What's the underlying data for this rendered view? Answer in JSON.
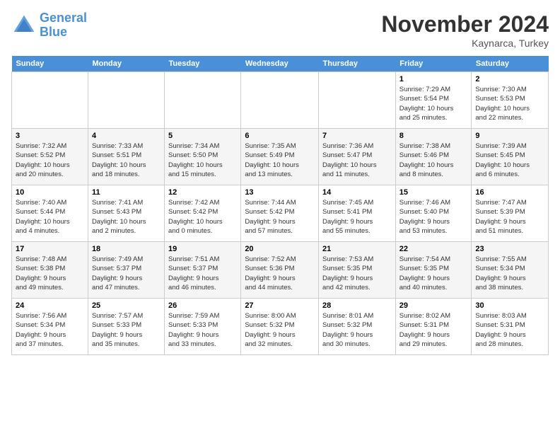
{
  "logo": {
    "line1": "General",
    "line2": "Blue"
  },
  "title": "November 2024",
  "subtitle": "Kaynarca, Turkey",
  "days_of_week": [
    "Sunday",
    "Monday",
    "Tuesday",
    "Wednesday",
    "Thursday",
    "Friday",
    "Saturday"
  ],
  "weeks": [
    [
      {
        "day": "",
        "info": ""
      },
      {
        "day": "",
        "info": ""
      },
      {
        "day": "",
        "info": ""
      },
      {
        "day": "",
        "info": ""
      },
      {
        "day": "",
        "info": ""
      },
      {
        "day": "1",
        "info": "Sunrise: 7:29 AM\nSunset: 5:54 PM\nDaylight: 10 hours\nand 25 minutes."
      },
      {
        "day": "2",
        "info": "Sunrise: 7:30 AM\nSunset: 5:53 PM\nDaylight: 10 hours\nand 22 minutes."
      }
    ],
    [
      {
        "day": "3",
        "info": "Sunrise: 7:32 AM\nSunset: 5:52 PM\nDaylight: 10 hours\nand 20 minutes."
      },
      {
        "day": "4",
        "info": "Sunrise: 7:33 AM\nSunset: 5:51 PM\nDaylight: 10 hours\nand 18 minutes."
      },
      {
        "day": "5",
        "info": "Sunrise: 7:34 AM\nSunset: 5:50 PM\nDaylight: 10 hours\nand 15 minutes."
      },
      {
        "day": "6",
        "info": "Sunrise: 7:35 AM\nSunset: 5:49 PM\nDaylight: 10 hours\nand 13 minutes."
      },
      {
        "day": "7",
        "info": "Sunrise: 7:36 AM\nSunset: 5:47 PM\nDaylight: 10 hours\nand 11 minutes."
      },
      {
        "day": "8",
        "info": "Sunrise: 7:38 AM\nSunset: 5:46 PM\nDaylight: 10 hours\nand 8 minutes."
      },
      {
        "day": "9",
        "info": "Sunrise: 7:39 AM\nSunset: 5:45 PM\nDaylight: 10 hours\nand 6 minutes."
      }
    ],
    [
      {
        "day": "10",
        "info": "Sunrise: 7:40 AM\nSunset: 5:44 PM\nDaylight: 10 hours\nand 4 minutes."
      },
      {
        "day": "11",
        "info": "Sunrise: 7:41 AM\nSunset: 5:43 PM\nDaylight: 10 hours\nand 2 minutes."
      },
      {
        "day": "12",
        "info": "Sunrise: 7:42 AM\nSunset: 5:42 PM\nDaylight: 10 hours\nand 0 minutes."
      },
      {
        "day": "13",
        "info": "Sunrise: 7:44 AM\nSunset: 5:42 PM\nDaylight: 9 hours\nand 57 minutes."
      },
      {
        "day": "14",
        "info": "Sunrise: 7:45 AM\nSunset: 5:41 PM\nDaylight: 9 hours\nand 55 minutes."
      },
      {
        "day": "15",
        "info": "Sunrise: 7:46 AM\nSunset: 5:40 PM\nDaylight: 9 hours\nand 53 minutes."
      },
      {
        "day": "16",
        "info": "Sunrise: 7:47 AM\nSunset: 5:39 PM\nDaylight: 9 hours\nand 51 minutes."
      }
    ],
    [
      {
        "day": "17",
        "info": "Sunrise: 7:48 AM\nSunset: 5:38 PM\nDaylight: 9 hours\nand 49 minutes."
      },
      {
        "day": "18",
        "info": "Sunrise: 7:49 AM\nSunset: 5:37 PM\nDaylight: 9 hours\nand 47 minutes."
      },
      {
        "day": "19",
        "info": "Sunrise: 7:51 AM\nSunset: 5:37 PM\nDaylight: 9 hours\nand 46 minutes."
      },
      {
        "day": "20",
        "info": "Sunrise: 7:52 AM\nSunset: 5:36 PM\nDaylight: 9 hours\nand 44 minutes."
      },
      {
        "day": "21",
        "info": "Sunrise: 7:53 AM\nSunset: 5:35 PM\nDaylight: 9 hours\nand 42 minutes."
      },
      {
        "day": "22",
        "info": "Sunrise: 7:54 AM\nSunset: 5:35 PM\nDaylight: 9 hours\nand 40 minutes."
      },
      {
        "day": "23",
        "info": "Sunrise: 7:55 AM\nSunset: 5:34 PM\nDaylight: 9 hours\nand 38 minutes."
      }
    ],
    [
      {
        "day": "24",
        "info": "Sunrise: 7:56 AM\nSunset: 5:34 PM\nDaylight: 9 hours\nand 37 minutes."
      },
      {
        "day": "25",
        "info": "Sunrise: 7:57 AM\nSunset: 5:33 PM\nDaylight: 9 hours\nand 35 minutes."
      },
      {
        "day": "26",
        "info": "Sunrise: 7:59 AM\nSunset: 5:33 PM\nDaylight: 9 hours\nand 33 minutes."
      },
      {
        "day": "27",
        "info": "Sunrise: 8:00 AM\nSunset: 5:32 PM\nDaylight: 9 hours\nand 32 minutes."
      },
      {
        "day": "28",
        "info": "Sunrise: 8:01 AM\nSunset: 5:32 PM\nDaylight: 9 hours\nand 30 minutes."
      },
      {
        "day": "29",
        "info": "Sunrise: 8:02 AM\nSunset: 5:31 PM\nDaylight: 9 hours\nand 29 minutes."
      },
      {
        "day": "30",
        "info": "Sunrise: 8:03 AM\nSunset: 5:31 PM\nDaylight: 9 hours\nand 28 minutes."
      }
    ]
  ]
}
